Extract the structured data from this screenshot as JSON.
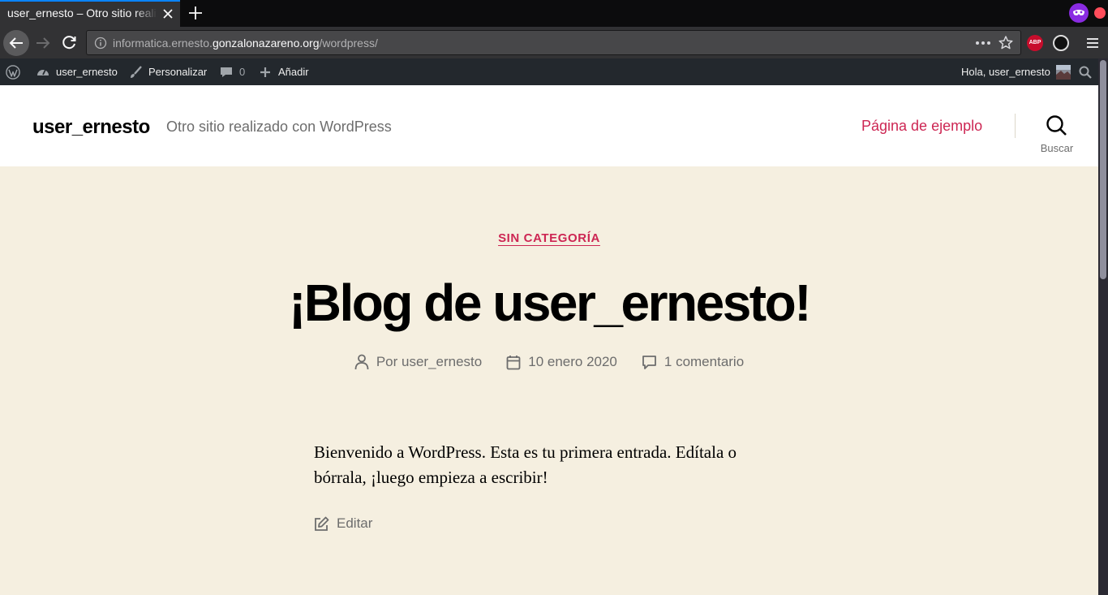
{
  "browser": {
    "tab_title": "user_ernesto – Otro sitio realizado con WordPress",
    "url_prefix": "informatica.ernesto.",
    "url_host": "gonzalonazareno.org",
    "url_path": "/wordpress/",
    "accent": "#0a84ff",
    "extensions": [
      {
        "icon": "mask-icon",
        "color": "#8a2be2"
      },
      {
        "icon": "adblock-plus-icon",
        "label": "ABP",
        "color": "#c70d2c"
      },
      {
        "icon": "extension-icon"
      }
    ]
  },
  "adminbar": {
    "site_name": "user_ernesto",
    "customize": "Personalizar",
    "comments_count": "0",
    "add_new": "Añadir",
    "greeting": "Hola, user_ernesto"
  },
  "header": {
    "site_title": "user_ernesto",
    "tagline": "Otro sitio realizado con WordPress",
    "menu_item": "Página de ejemplo",
    "search_label": "Buscar",
    "accent": "#cd2653",
    "background": "#f5efe0"
  },
  "post": {
    "category": "SIN CATEGORÍA",
    "title": "¡Blog de user_ernesto!",
    "author": "Por user_ernesto",
    "date": "10 enero 2020",
    "comments": "1 comentario",
    "content": "Bienvenido a WordPress. Esta es tu primera entrada. Edítala o bórrala, ¡luego empieza a escribir!",
    "edit": "Editar"
  }
}
